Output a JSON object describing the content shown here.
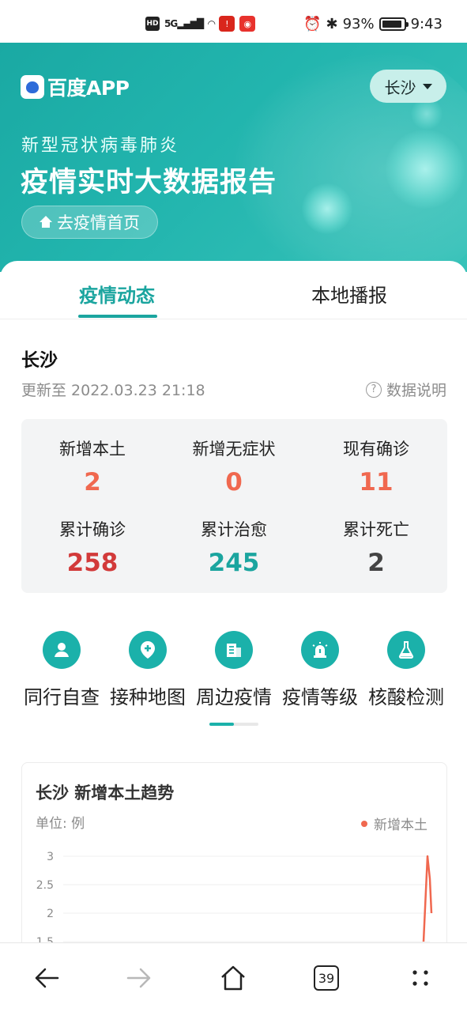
{
  "status_bar": {
    "hd": "HD",
    "signal": "5G",
    "battery_pct": "93%",
    "time": "9:43"
  },
  "hero": {
    "logo_text": "百度APP",
    "city": "长沙",
    "subtitle": "新型冠状病毒肺炎",
    "title": "疫情实时大数据报告",
    "home_button": "去疫情首页"
  },
  "tabs": [
    {
      "label": "疫情动态",
      "active": true
    },
    {
      "label": "本地播报",
      "active": false
    }
  ],
  "region": {
    "name": "长沙",
    "updated": "更新至 2022.03.23 21:18",
    "explain_link": "数据说明"
  },
  "stats": [
    {
      "label": "新增本土",
      "value": "2",
      "color": "#f0684f"
    },
    {
      "label": "新增无症状",
      "value": "0",
      "color": "#f0684f"
    },
    {
      "label": "现有确诊",
      "value": "11",
      "color": "#f0684f"
    },
    {
      "label": "累计确诊",
      "value": "258",
      "color": "#d23a3a"
    },
    {
      "label": "累计治愈",
      "value": "245",
      "color": "#1ba59f"
    },
    {
      "label": "累计死亡",
      "value": "2",
      "color": "#444444"
    }
  ],
  "quick_links": [
    {
      "label": "同行自查",
      "icon": "user-icon"
    },
    {
      "label": "接种地图",
      "icon": "map-pin-plus-icon"
    },
    {
      "label": "周边疫情",
      "icon": "building-icon"
    },
    {
      "label": "疫情等级",
      "icon": "alarm-light-icon"
    },
    {
      "label": "核酸检测",
      "icon": "flask-icon"
    }
  ],
  "trend_card": {
    "title": "长沙 新增本土趋势",
    "unit": "单位: 例",
    "legend": "新增本土",
    "line_color": "#f0684f"
  },
  "chart_data": {
    "type": "line",
    "title": "长沙 新增本土趋势",
    "ylabel": "单位: 例",
    "y_ticks": [
      "3",
      "2.5",
      "2",
      "1.5"
    ],
    "ylim": [
      1.5,
      3
    ],
    "series": [
      {
        "name": "新增本土",
        "values": [
          1.5,
          3,
          2.6,
          2
        ]
      }
    ],
    "legend_position": "top-right",
    "grid": true
  },
  "bottom_nav": {
    "tab_count": "39"
  }
}
